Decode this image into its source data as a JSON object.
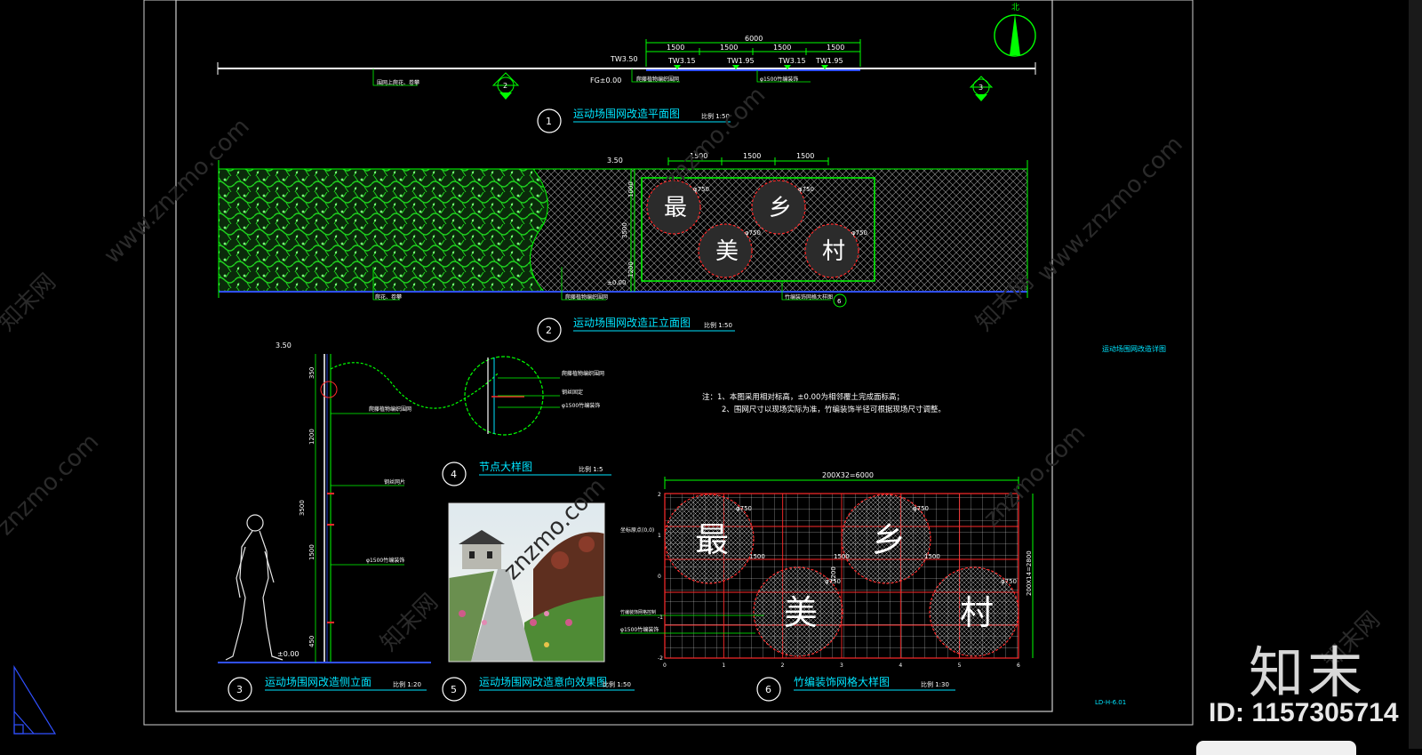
{
  "colors": {
    "green": "#00ff00",
    "cyan": "#00e5ff",
    "white": "#ffffff",
    "red": "#ff2a2a",
    "frame": "#cfcfcf",
    "blue": "#3050ff"
  },
  "watermark": {
    "texts": [
      "www.znzmo.com",
      "知末网",
      "znzmo.com"
    ]
  },
  "brand": {
    "logo": "知末",
    "id": "ID: 1157305714"
  },
  "north": "北",
  "plan": {
    "total": "6000",
    "segs": [
      "1500",
      "1500",
      "1500",
      "1500"
    ],
    "tw": [
      "TW3.50",
      "TW3.15",
      "TW1.95",
      "TW3.15",
      "TW1.95"
    ],
    "fg": "FG±0.00",
    "labels": [
      "围网上爬花、卷攀",
      "爬藤植物编织围网",
      "φ1500竹编装饰"
    ],
    "section_a": "2",
    "section_b": "3",
    "num": "1",
    "title": "运动场围网改造平面图",
    "scale": "比例 1:50"
  },
  "front": {
    "top": "3.50",
    "bottom": "±0.00",
    "dims": [
      "1500",
      "1500",
      "1500"
    ],
    "vdims": [
      "1000",
      "3500",
      "1200"
    ],
    "chars": [
      "最",
      "乡",
      "美",
      "村"
    ],
    "phis": [
      "φ750",
      "φ750",
      "φ750",
      "φ750"
    ],
    "labels": [
      "爬花、卷攀",
      "爬藤植物编织围网",
      "竹编装饰网格大样图"
    ],
    "detail": "6",
    "num": "2",
    "title": "运动场围网改造正立面图",
    "scale": "比例 1:50"
  },
  "side": {
    "top": "3.50",
    "bottom": "±0.00",
    "vdims": [
      "350",
      "1200",
      "3500",
      "1500",
      "450"
    ],
    "labels": [
      "爬藤植物编织围网",
      "钢丝网片",
      "φ1500竹编装饰"
    ],
    "num": "3",
    "title": "运动场围网改造侧立面",
    "scale": "比例 1:20"
  },
  "node": {
    "labels": [
      "爬藤植物编织围网",
      "钢丝固定",
      "φ1500竹编装饰"
    ],
    "num": "4",
    "title": "节点大样图",
    "scale": "比例 1:5"
  },
  "effect": {
    "num": "5",
    "title": "运动场围网改造意向效果图",
    "scale": "比例 1:50"
  },
  "grid": {
    "total": "200X32=6000",
    "vtotal": "200X14=2800",
    "origin": "坐标原点(0,0)",
    "chars": [
      "最",
      "乡",
      "美",
      "村"
    ],
    "phis": [
      "φ750",
      "φ750",
      "φ750",
      "φ750"
    ],
    "inner": [
      "1500",
      "1500",
      "1500",
      "1200"
    ],
    "labels": [
      "竹编装饰网格控制",
      "φ1500竹编装饰"
    ],
    "xticks": [
      "0",
      "1",
      "2",
      "3",
      "4",
      "5",
      "6"
    ],
    "yticks": [
      "2",
      "1",
      "0",
      "-1",
      "-2"
    ],
    "num": "6",
    "title": "竹编装饰网格大样图",
    "scale": "比例 1:30"
  },
  "notes": {
    "line1": "注：1、本图采用相对标高，±0.00为相邻覆土完成面标高；",
    "line2": "2、围网尺寸以现场实际为准，竹编装饰半径可根据现场尺寸调整。"
  },
  "sheet": {
    "title": "运动场围网改造详图",
    "code": "LD-H-6.01"
  }
}
